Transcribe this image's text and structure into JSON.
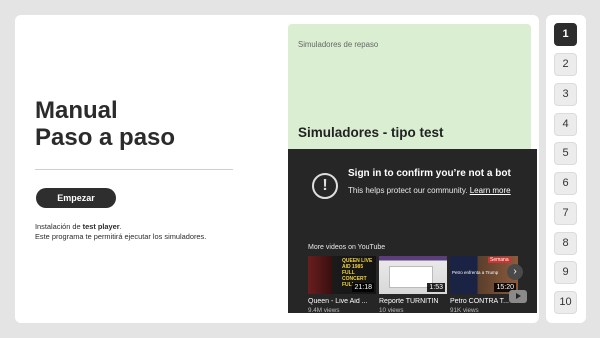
{
  "left": {
    "title_line1": "Manual",
    "title_line2": "Paso a paso",
    "start_button": "Empezar",
    "desc_prefix": "Instalación de ",
    "desc_bold": "test player",
    "desc_suffix": ".",
    "desc_line2": "Este programa te permitirá ejecutar los simuladores."
  },
  "sim_card": {
    "small_label": "Simuladores de repaso",
    "title": "Simuladores - tipo test"
  },
  "youtube": {
    "heading": "Sign in to confirm you’re not a bot",
    "sub_text": "This helps protect our community. ",
    "learn_more": "Learn more",
    "more_videos": "More videos on YouTube",
    "videos": [
      {
        "title": "Queen - Live Aid ...",
        "views": "9.4M views",
        "duration": "21:18",
        "thumb_text": "QUEEN LIVE AID 1985 FULL CONCERT FULL"
      },
      {
        "title": "Reporte TURNITIN",
        "views": "10 views",
        "duration": "1:53"
      },
      {
        "title": "Petro CONTRA T...",
        "views": "91K views",
        "duration": "15:20",
        "thumb_text": "Petro enfrenta a Trump",
        "thumb_tag": "Semana"
      }
    ]
  },
  "nav": {
    "items": [
      "1",
      "2",
      "3",
      "4",
      "5",
      "6",
      "7",
      "8",
      "9",
      "10"
    ],
    "active": "1"
  }
}
